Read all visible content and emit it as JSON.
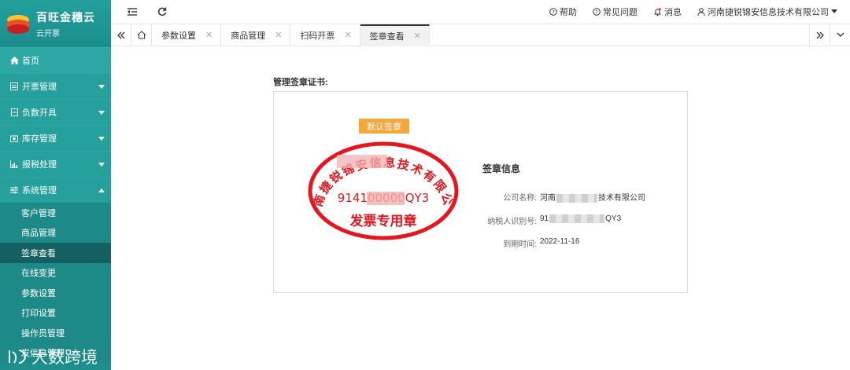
{
  "brand": {
    "title": "百旺金穗云",
    "subtitle": "云开票"
  },
  "sidebar": {
    "items": [
      {
        "label": "首页"
      },
      {
        "label": "开票管理"
      },
      {
        "label": "负数开具"
      },
      {
        "label": "库存管理"
      },
      {
        "label": "报税处理"
      },
      {
        "label": "系统管理"
      }
    ],
    "sub_items": [
      {
        "label": "客户管理"
      },
      {
        "label": "商品管理"
      },
      {
        "label": "签章查看"
      },
      {
        "label": "在线变更"
      },
      {
        "label": "参数设置"
      },
      {
        "label": "打印设置"
      },
      {
        "label": "操作员管理"
      },
      {
        "label": "发信息管理"
      }
    ]
  },
  "topbar": {
    "help": "帮助",
    "faq": "常见问题",
    "messages": "消息",
    "company": "河南捷锐锦安信息技术有限公司"
  },
  "tabs": [
    {
      "label": "参数设置"
    },
    {
      "label": "商品管理"
    },
    {
      "label": "扫码开票"
    },
    {
      "label": "签章查看"
    }
  ],
  "content": {
    "section_label": "管理签章证书:",
    "default_badge": "默认签章",
    "seal": {
      "top_text": "河南捷锐锦安信息技术有限公司",
      "tax_id": "914100000QY3",
      "bottom_text": "发票专用章"
    },
    "info": {
      "title": "签章信息",
      "company_key": "公司名称:",
      "company_val_prefix": "河南",
      "company_val_suffix": "技术有限公司",
      "taxid_key": "纳税人识别号:",
      "taxid_val_prefix": "91",
      "taxid_val_suffix": "QY3",
      "expire_key": "到期时间:",
      "expire_val": "2022-11-16"
    }
  },
  "watermark": {
    "text": "大数跨境"
  },
  "colors": {
    "sidebar": "#1f8f8e",
    "active_sub": "#145f5f",
    "badge": "#f4a83b",
    "seal": "#e6161f"
  }
}
